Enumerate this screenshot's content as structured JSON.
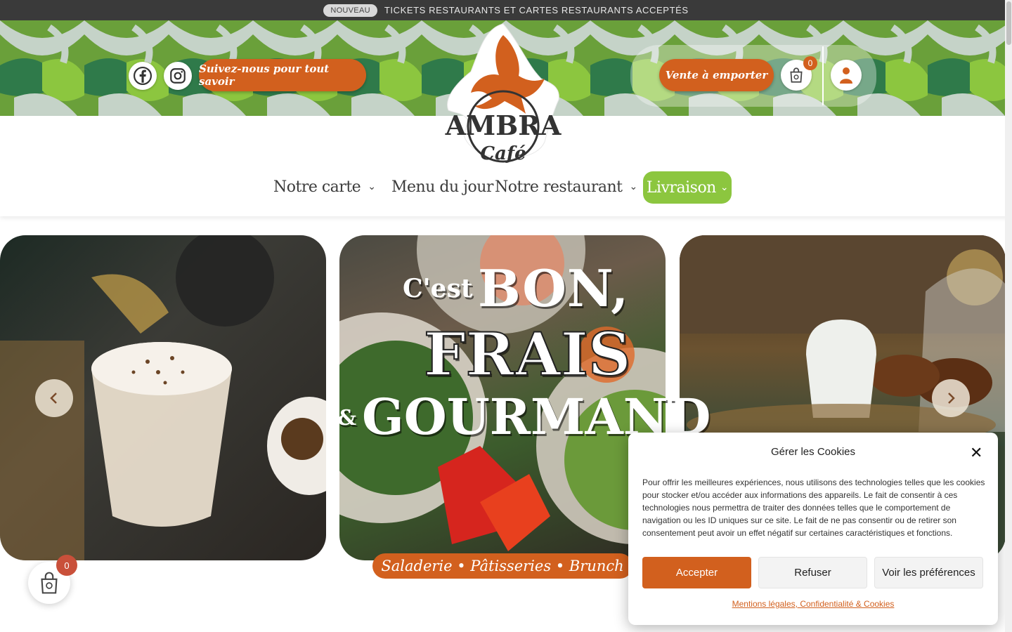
{
  "topbar": {
    "badge": "NOUVEAU",
    "message": "TICKETS RESTAURANTS ET CARTES RESTAURANTS ACCEPTÉS"
  },
  "header": {
    "social": [
      {
        "icon": "facebook-icon"
      },
      {
        "icon": "instagram-icon"
      }
    ],
    "follow_label": "Suivez-nous pour tout savoir",
    "takeaway_label": "Vente à emporter",
    "cart_count": "0",
    "logo": {
      "name": "AMBRA",
      "sub": "Café"
    }
  },
  "nav": {
    "items": [
      {
        "label": "Notre carte",
        "dropdown": true
      },
      {
        "label": "Menu du jour",
        "dropdown": false
      },
      {
        "label": "Notre restaurant",
        "dropdown": true
      },
      {
        "label": "Livraison",
        "dropdown": true
      }
    ]
  },
  "hero": {
    "line1a": "C'est",
    "line1b": "BON,",
    "line2": "FRAIS",
    "line3a": "&",
    "line3b": "GOURMAND",
    "tagline": "Saladerie • Pâtisseries • Brunch",
    "prev_icon": "chevron-left-icon",
    "next_icon": "chevron-right-icon"
  },
  "floating_cart": {
    "count": "0"
  },
  "cookie": {
    "title": "Gérer les Cookies",
    "text": "Pour offrir les meilleures expériences, nous utilisons des technologies telles que les cookies pour stocker et/ou accéder aux informations des appareils. Le fait de consentir à ces technologies nous permettra de traiter des données telles que le comportement de navigation ou les ID uniques sur ce site. Le fait de ne pas consentir ou de retirer son consentement peut avoir un effet négatif sur certaines caractéristiques et fonctions.",
    "accept": "Accepter",
    "refuse": "Refuser",
    "preferences": "Voir les préférences",
    "link": "Mentions légales, Confidentialité & Cookies"
  },
  "colors": {
    "accent_orange": "#d2601e",
    "accent_green": "#8cc63f",
    "topbar": "#3a3a3a"
  }
}
